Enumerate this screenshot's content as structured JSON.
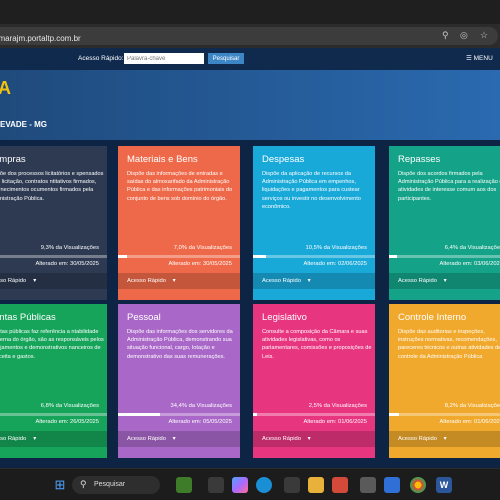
{
  "browser": {
    "url": "camarajm.portaltp.com.br"
  },
  "site": {
    "quick_access_label": "Acesso Rápido:",
    "search_placeholder": "Palavra-chave",
    "search_button": "Pesquisar",
    "menu_label": "MENU",
    "hero_letter": "A",
    "hero_subtitle": "EVADE - MG"
  },
  "cards": [
    {
      "title": "ompras",
      "description": "spõe dos processos licitatórios e spensados de licitação, contratos ntitativos firmados, fornecimentos ocumentos firmados pela ministração Pública.",
      "views": "9,3% da Visualizações",
      "views_pct": 0.093,
      "date": "Alterado em: 30/05/2025",
      "footer": "esso Rápido",
      "color": "#2d3a52"
    },
    {
      "title": "Materiais e Bens",
      "description": "Dispõe das informações de entradas e saídas do almoxarifado da Administração Pública e das informações patrimoniais do conjunto de bens sob domínio do órgão.",
      "views": "7,0% da Visualizações",
      "views_pct": 0.07,
      "date": "Alterado em: 30/05/2025",
      "footer": "Acesso Rápido",
      "color": "#ee6949"
    },
    {
      "title": "Despesas",
      "description": "Dispõe da aplicação de recursos da Administração Pública em empenhos, liquidações e pagamentos para custear serviços ou investir no desenvolvimento econômico.",
      "views": "10,5% da Visualizações",
      "views_pct": 0.105,
      "date": "Alterado em: 02/06/2025",
      "footer": "Acesso Rápido",
      "color": "#19a9d9"
    },
    {
      "title": "Repasses",
      "description": "Dispõe dos acordos firmados pela Administração Pública para a realização de atividades de interesse comum aos dos participantes.",
      "views": "6,4% da Visualizações",
      "views_pct": 0.064,
      "date": "Alterado em: 03/06/2025",
      "footer": "Acesso Rápido",
      "color": "#14a388"
    },
    {
      "title": "ontas Públicas",
      "description": "ontas públicas faz referência a ntabilidade interna do órgão, são as responsáveis pelos nejamentos e demonstrativos nanceiros de receita e gastos.",
      "views": "6,8% da Visualizações",
      "views_pct": 0.068,
      "date": "Alterado em: 26/05/2025",
      "footer": "esso Rápido",
      "color": "#16a35a"
    },
    {
      "title": "Pessoal",
      "description": "Dispõe das informações dos servidores da Administração Pública, demonstrando sua situação funcional, cargo, lotação e demonstrativo das suas remunerações.",
      "views": "34,4% da Visualizações",
      "views_pct": 0.344,
      "date": "Alterado em: 05/05/2025",
      "footer": "Acesso Rápido",
      "color": "#a968c8"
    },
    {
      "title": "Legislativo",
      "description": "Consulte a composição da Câmara e suas atividades legislativas, como os parlamentares, comissões e proposições de Leis.",
      "views": "2,5% da Visualizações",
      "views_pct": 0.025,
      "date": "Alterado em: 01/06/2025",
      "footer": "Acesso Rápido",
      "color": "#e83580"
    },
    {
      "title": "Controle Interno",
      "description": "Dispõe das auditorias e inspeções, instruções normativas, recomendações, pareceres técnicos e outras atividades de controle da Administração Pública",
      "views": "8,2% da Visualizações",
      "views_pct": 0.082,
      "date": "Alterado em: 01/06/2025",
      "footer": "Acesso Rápido",
      "color": "#f0a92c"
    }
  ],
  "taskbar": {
    "search_label": "Pesquisar"
  }
}
